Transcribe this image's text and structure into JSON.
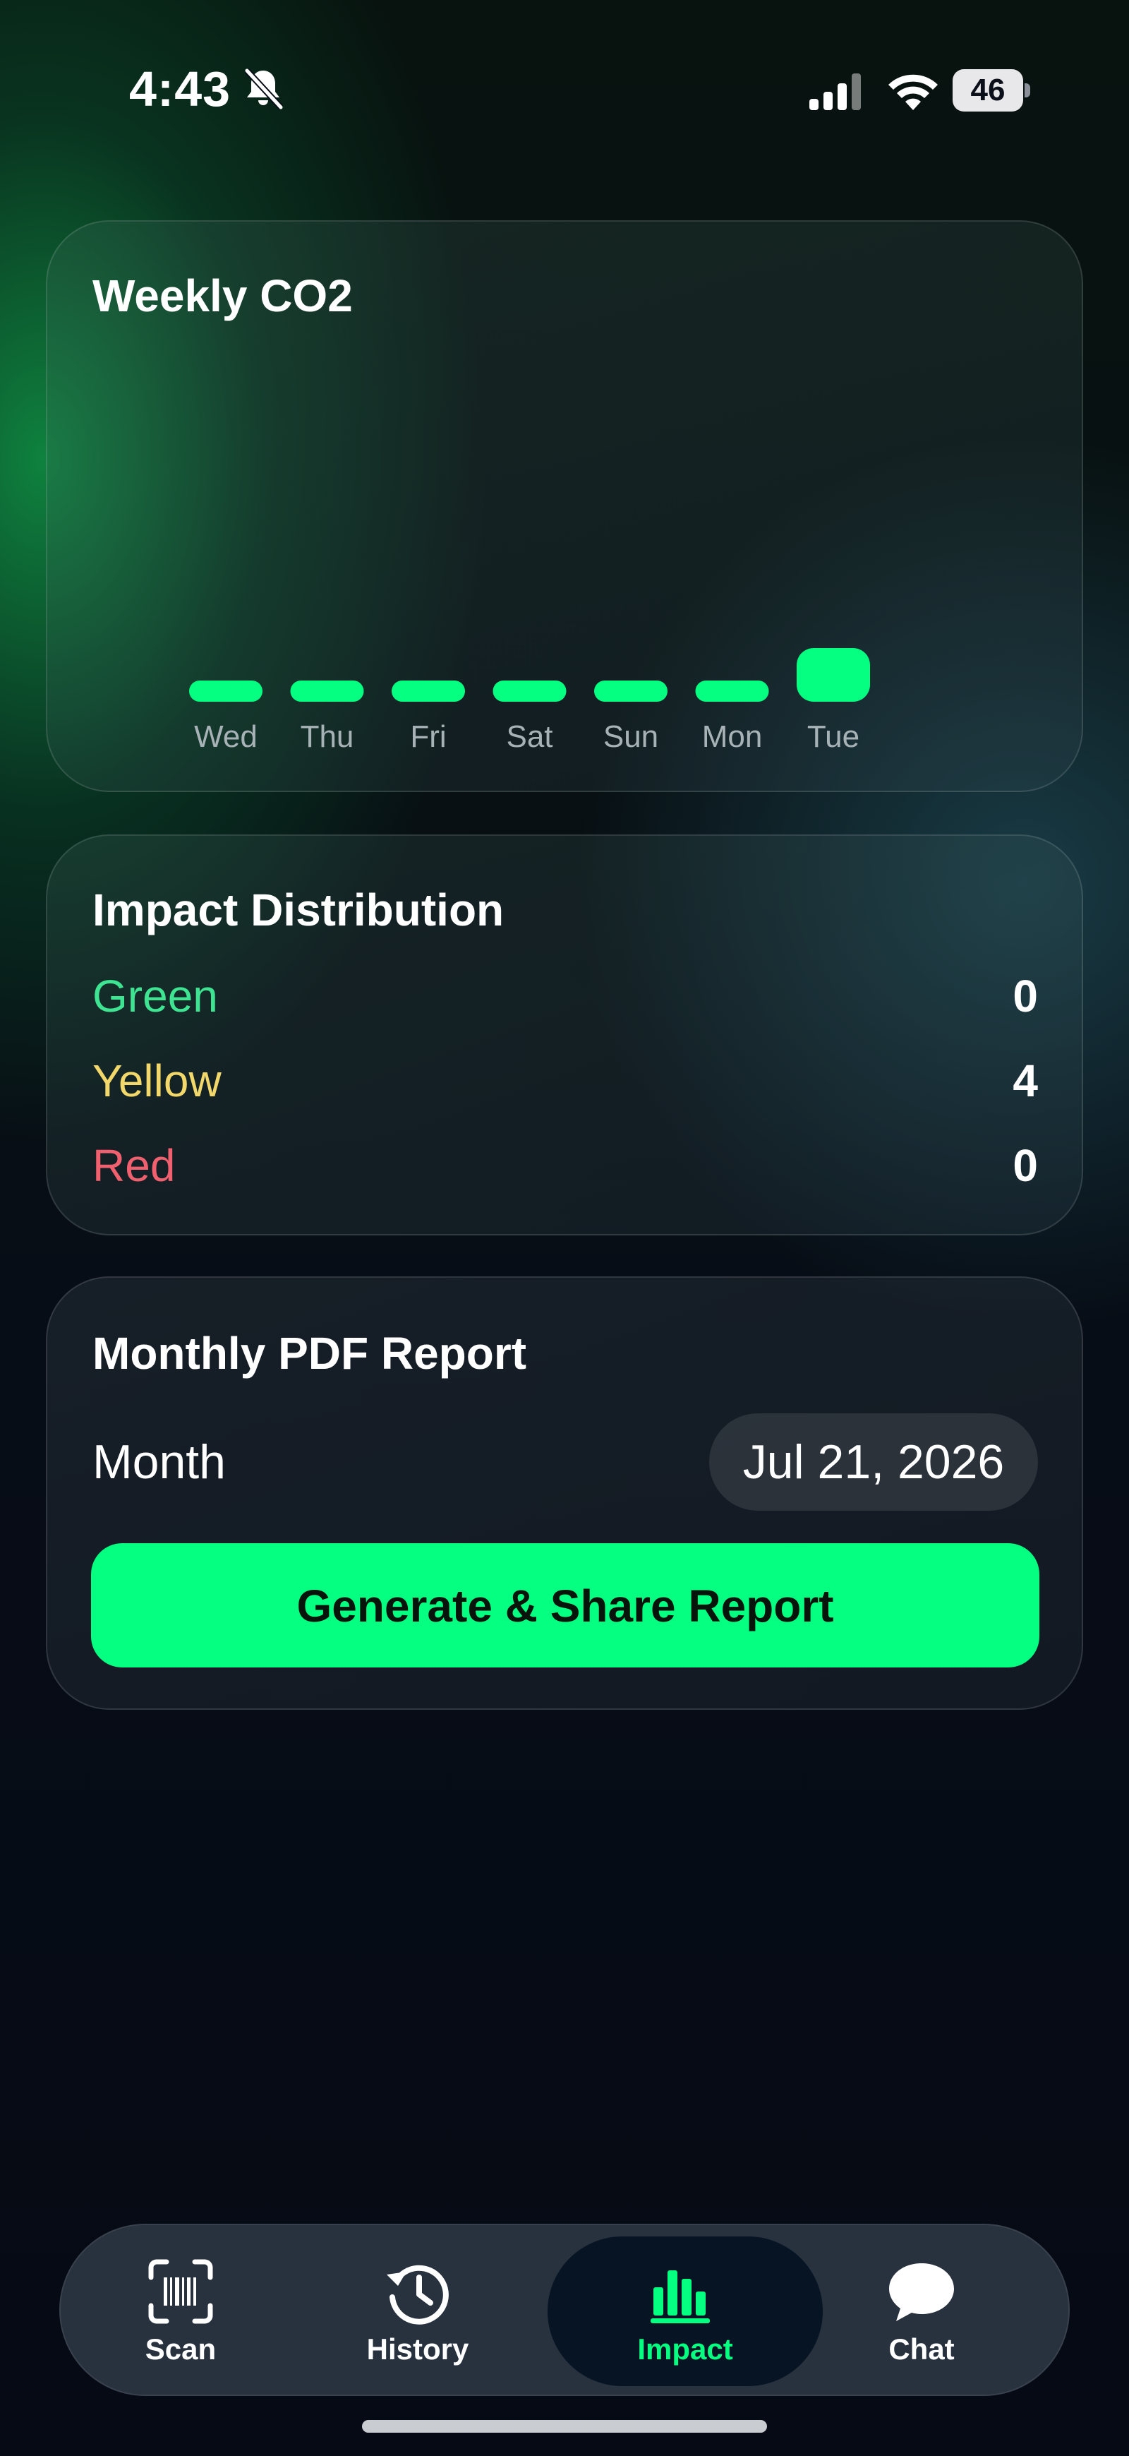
{
  "status_bar": {
    "time": "4:43",
    "battery": "46"
  },
  "weekly_co2": {
    "title": "Weekly CO2"
  },
  "chart_data": {
    "type": "bar",
    "title": "Weekly CO2",
    "categories": [
      "Wed",
      "Thu",
      "Fri",
      "Sat",
      "Sun",
      "Mon",
      "Tue"
    ],
    "values": [
      0,
      0,
      0,
      0,
      0,
      0,
      1
    ],
    "bar_color": "#05ff80"
  },
  "impact_distribution": {
    "title": "Impact Distribution",
    "rows": [
      {
        "label": "Green",
        "value": "0",
        "color": "#3fe493"
      },
      {
        "label": "Yellow",
        "value": "4",
        "color": "#f2d86a"
      },
      {
        "label": "Red",
        "value": "0",
        "color": "#f0606f"
      }
    ]
  },
  "monthly_report": {
    "title": "Monthly PDF Report",
    "month_label": "Month",
    "month_value": "Jul 21, 2026",
    "button_label": "Generate & Share Report"
  },
  "tabs": [
    {
      "label": "Scan",
      "icon": "barcode-scan-icon",
      "active": false
    },
    {
      "label": "History",
      "icon": "history-clock-icon",
      "active": false
    },
    {
      "label": "Impact",
      "icon": "bar-chart-icon",
      "active": true
    },
    {
      "label": "Chat",
      "icon": "chat-bubble-icon",
      "active": false
    }
  ],
  "colors": {
    "accent": "#05ff80",
    "background": "#070c16"
  }
}
